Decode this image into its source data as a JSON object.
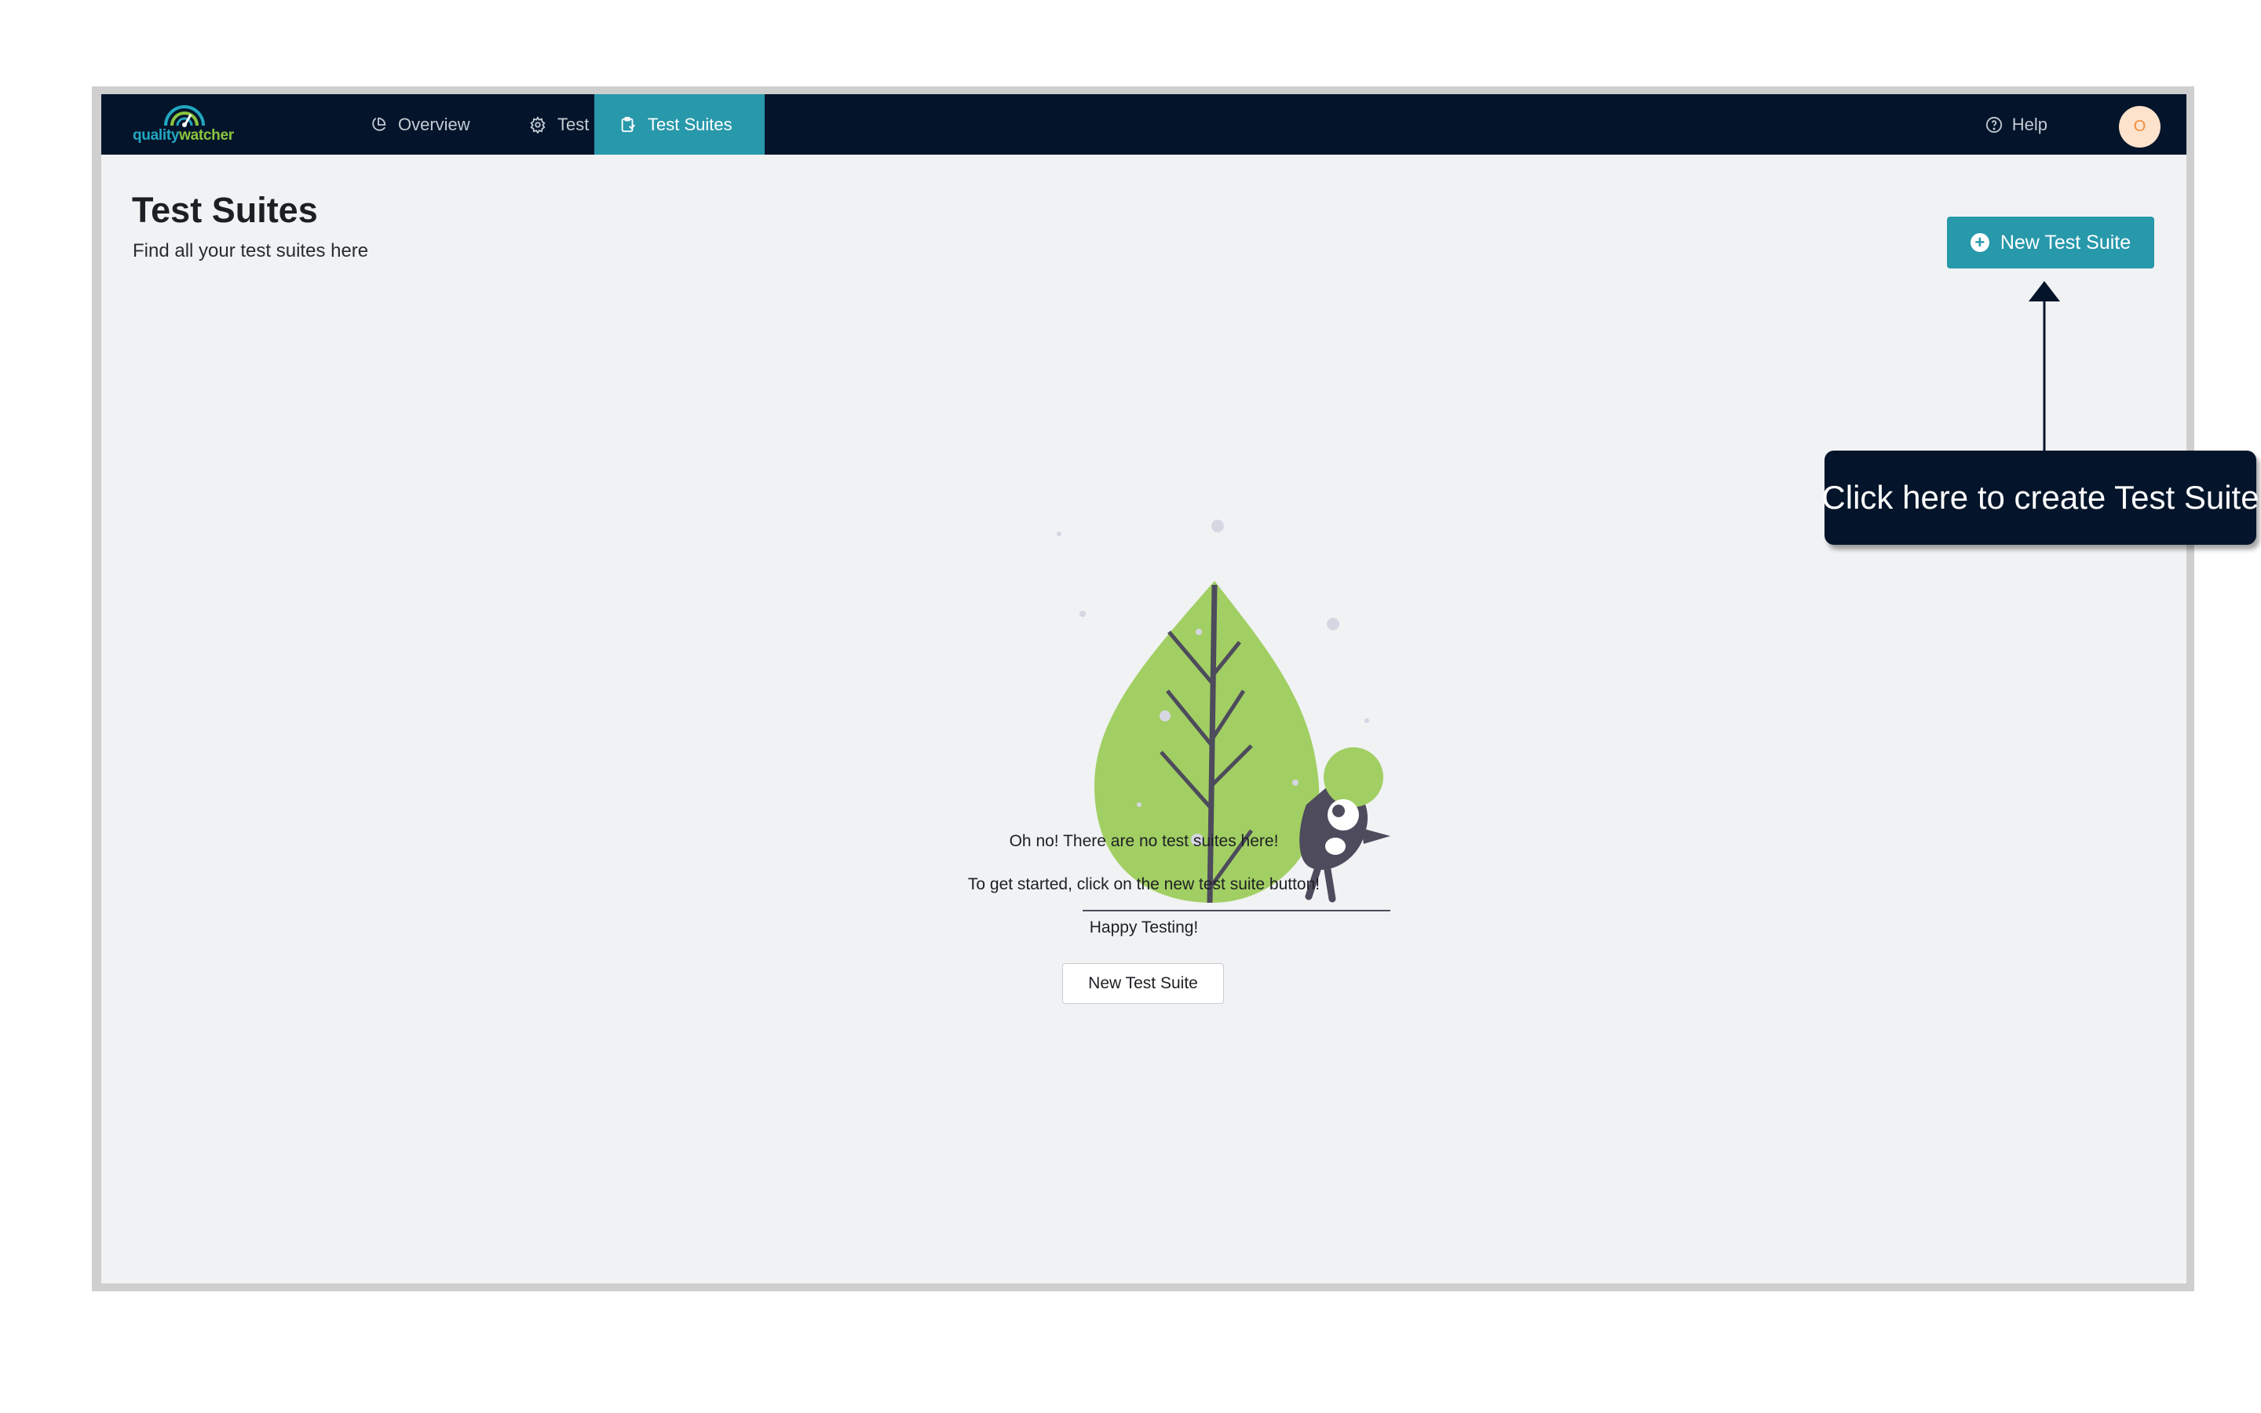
{
  "app": {
    "logo": {
      "part1": "quality",
      "part2": "watcher"
    },
    "colors": {
      "navbar": "#04152b",
      "accent": "#2898ab",
      "leaf": "#a1cf63",
      "figure": "#4d4b5c"
    }
  },
  "nav": {
    "items": [
      {
        "label": "Overview",
        "icon": "pie-chart-icon"
      },
      {
        "label": "Test Runs",
        "icon": "gear-icon"
      },
      {
        "label": "Test Suites",
        "icon": "clipboard-icon",
        "active": true
      }
    ],
    "help": {
      "label": "Help",
      "icon": "question-circle-icon"
    },
    "avatar_initial": "O"
  },
  "page": {
    "title": "Test Suites",
    "subtitle": "Find all your test suites here",
    "new_button": "New Test Suite"
  },
  "empty_state": {
    "line1": "Oh no! There are no test suites here!",
    "line2": "To get started, click on the new test suite button!",
    "line3": "Happy Testing!",
    "button": "New Test Suite"
  },
  "callout": {
    "text": "Click here to create Test Suite"
  }
}
